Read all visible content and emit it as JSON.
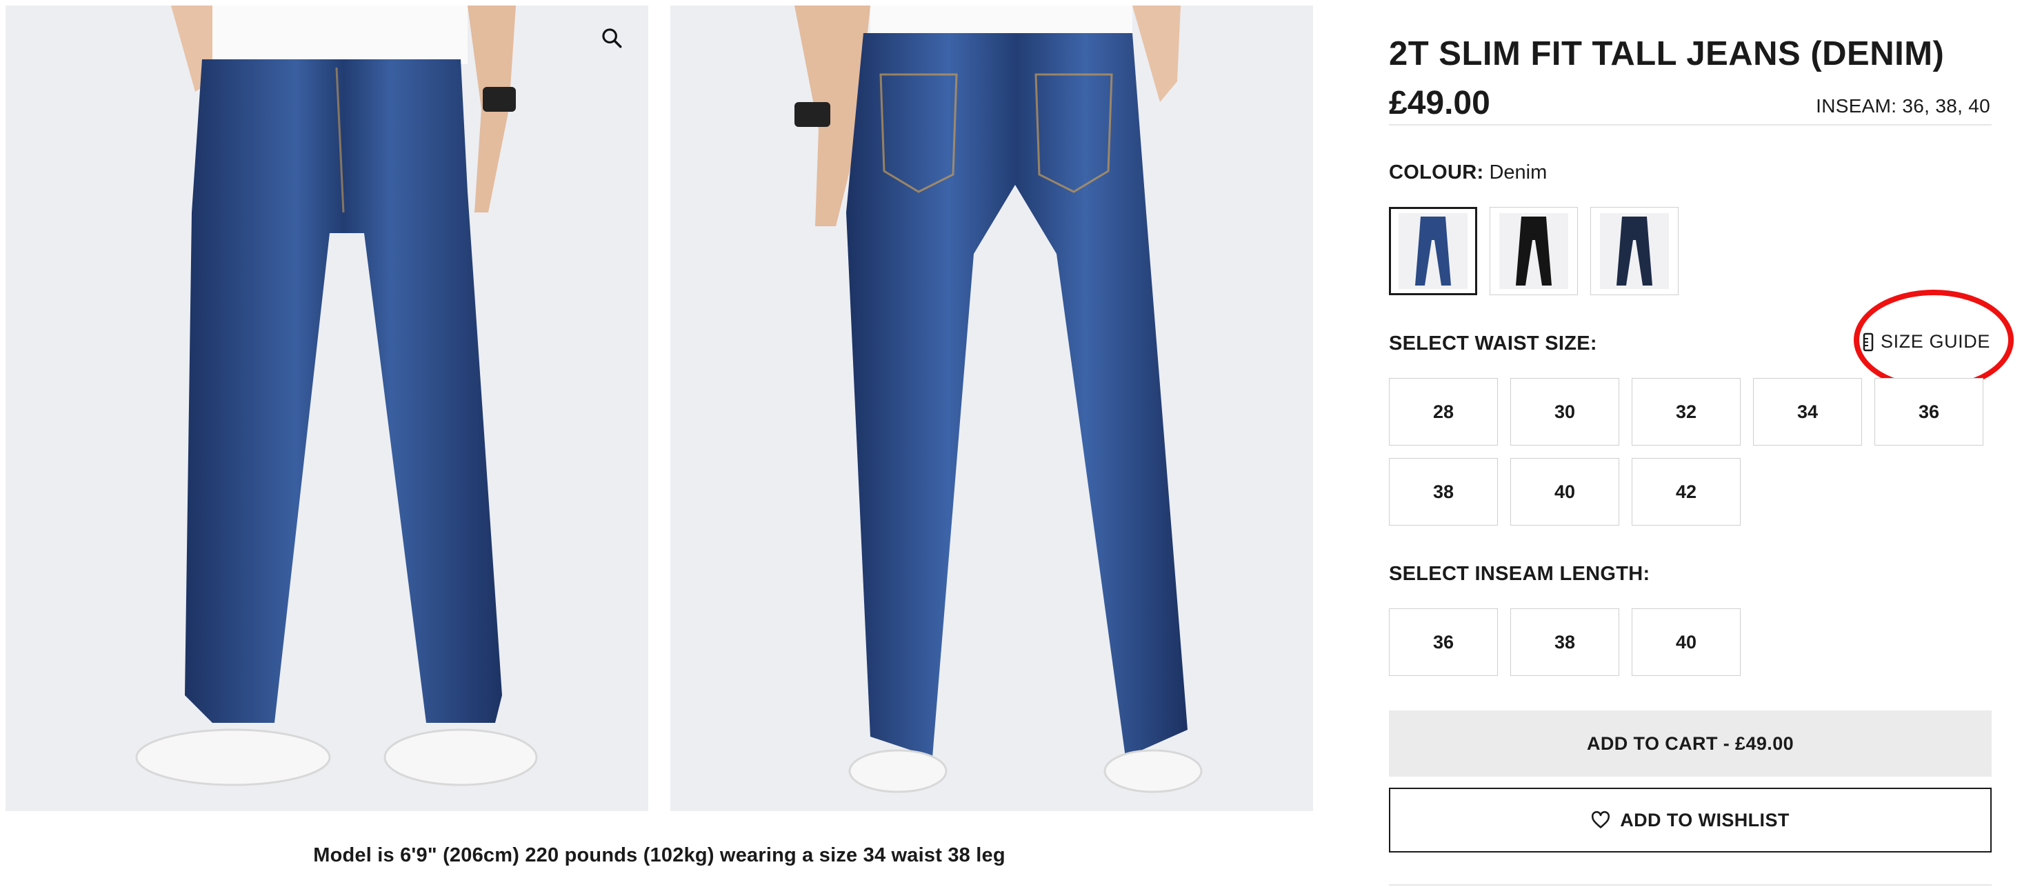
{
  "gallery": {
    "front_image_alt": "",
    "back_image_alt": "",
    "zoom_icon": "search-icon",
    "caption": "Model is 6'9\" (206cm) 220 pounds (102kg) wearing a size 34 waist 38 leg"
  },
  "product": {
    "title": "2T SLIM FIT TALL JEANS (DENIM)",
    "price": "£49.00",
    "inseam_summary": "INSEAM: 36, 38, 40"
  },
  "colour": {
    "label": "COLOUR:",
    "selected": "Denim",
    "swatches": [
      {
        "name": "denim",
        "color": "#2b4a86",
        "selected": true
      },
      {
        "name": "black",
        "color": "#151515",
        "selected": false
      },
      {
        "name": "dark-navy",
        "color": "#1e2b47",
        "selected": false
      }
    ]
  },
  "waist": {
    "label": "SELECT WAIST SIZE:",
    "size_guide": "SIZE GUIDE",
    "size_guide_icon": "ruler-icon",
    "sizes": [
      "28",
      "30",
      "32",
      "34",
      "36",
      "38",
      "40",
      "42"
    ]
  },
  "inseam": {
    "label": "SELECT INSEAM LENGTH:",
    "lengths": [
      "36",
      "38",
      "40"
    ]
  },
  "actions": {
    "add_to_cart": "ADD TO CART - £49.00",
    "wishlist": "ADD TO WISHLIST",
    "wishlist_icon": "heart-icon"
  },
  "colors": {
    "highlight": "#ef1010",
    "denim": "#2b4a86",
    "button_grey": "#ebebeb"
  }
}
